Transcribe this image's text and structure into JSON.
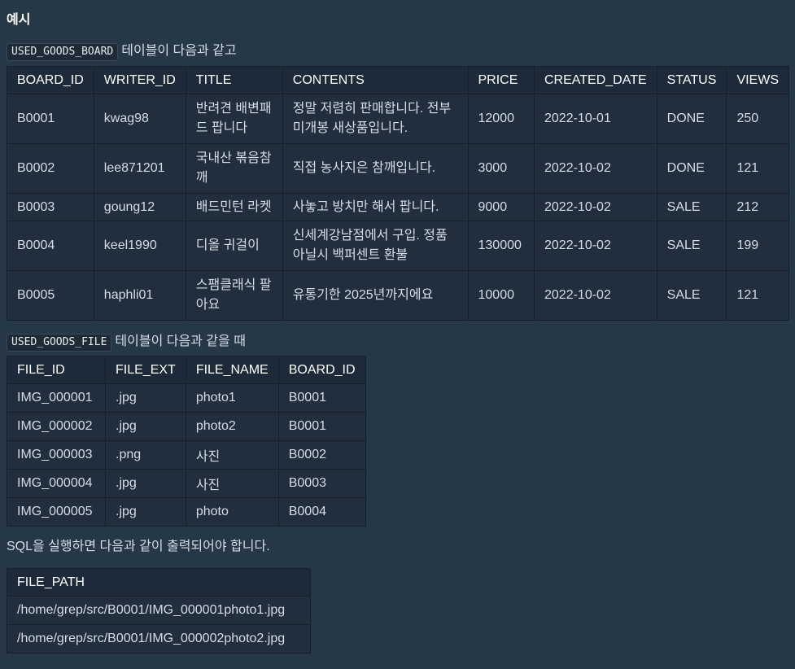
{
  "heading": "예시",
  "intro1": {
    "code": "USED_GOODS_BOARD",
    "text": "테이블이 다음과 같고"
  },
  "board_table": {
    "headers": [
      "BOARD_ID",
      "WRITER_ID",
      "TITLE",
      "CONTENTS",
      "PRICE",
      "CREATED_DATE",
      "STATUS",
      "VIEWS"
    ],
    "rows": [
      [
        "B0001",
        "kwag98",
        "반려견 배변패드 팝니다",
        "정말 저렴히 판매합니다. 전부 미개봉 새상품입니다.",
        "12000",
        "2022-10-01",
        "DONE",
        "250"
      ],
      [
        "B0002",
        "lee871201",
        "국내산 볶음참깨",
        "직접 농사지은 참깨입니다.",
        "3000",
        "2022-10-02",
        "DONE",
        "121"
      ],
      [
        "B0003",
        "goung12",
        "배드민턴 라켓",
        "사놓고 방치만 해서 팝니다.",
        "9000",
        "2022-10-02",
        "SALE",
        "212"
      ],
      [
        "B0004",
        "keel1990",
        "디올 귀걸이",
        "신세계강남점에서 구입. 정품 아닐시 백퍼센트 환불",
        "130000",
        "2022-10-02",
        "SALE",
        "199"
      ],
      [
        "B0005",
        "haphli01",
        "스팸클래식 팔아요",
        "유통기한 2025년까지에요",
        "10000",
        "2022-10-02",
        "SALE",
        "121"
      ]
    ]
  },
  "intro2": {
    "code": "USED_GOODS_FILE",
    "text": "테이블이 다음과 같을 때"
  },
  "file_table": {
    "headers": [
      "FILE_ID",
      "FILE_EXT",
      "FILE_NAME",
      "BOARD_ID"
    ],
    "rows": [
      [
        "IMG_000001",
        ".jpg",
        "photo1",
        "B0001"
      ],
      [
        "IMG_000002",
        ".jpg",
        "photo2",
        "B0001"
      ],
      [
        "IMG_000003",
        ".png",
        "사진",
        "B0002"
      ],
      [
        "IMG_000004",
        ".jpg",
        "사진",
        "B0003"
      ],
      [
        "IMG_000005",
        ".jpg",
        "photo",
        "B0004"
      ]
    ]
  },
  "result_text": "SQL을 실행하면 다음과 같이 출력되어야 합니다.",
  "result_table": {
    "headers": [
      "FILE_PATH"
    ],
    "rows": [
      [
        "/home/grep/src/B0001/IMG_000001photo1.jpg"
      ],
      [
        "/home/grep/src/B0001/IMG_000002photo2.jpg"
      ]
    ]
  }
}
